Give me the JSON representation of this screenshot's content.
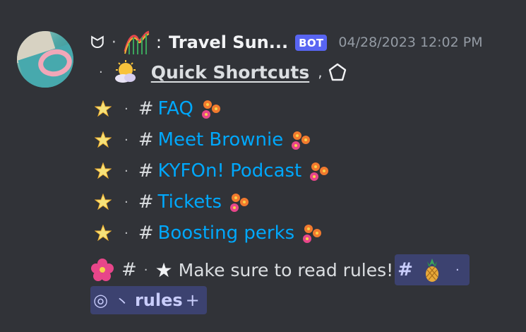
{
  "message": {
    "author": {
      "prefix_glyph": "ᗢ",
      "separator": "·",
      "colon": ":",
      "name": "Travel Sun...",
      "badge": "BOT",
      "avatar_icon": "avatar-pool-float"
    },
    "timestamp": "04/28/2023 12:02 PM",
    "shortcuts": {
      "dot": "·",
      "title": "Quick Shortcuts",
      "comma": ",",
      "icons": [
        "sun-cloud-emoji",
        "pentagon-icon"
      ]
    },
    "channels": [
      {
        "bullet": "·",
        "hash": "#",
        "name": "FAQ"
      },
      {
        "bullet": "·",
        "hash": "#",
        "name": "Meet Brownie"
      },
      {
        "bullet": "·",
        "hash": "#",
        "name": "KYFOn! Podcast"
      },
      {
        "bullet": "·",
        "hash": "#",
        "name": "Tickets"
      },
      {
        "bullet": "·",
        "hash": "#",
        "name": "Boosting perks"
      }
    ],
    "rules_line": {
      "hash": "#",
      "dot": "·",
      "star": "★",
      "text": "Make sure to read rules!",
      "channel_mention": {
        "hash": "#",
        "dot": "·",
        "icon": "pineapple-emoji"
      },
      "role_mention": {
        "ring": "◎",
        "mark": "丶",
        "name": "rules",
        "plus": "+"
      }
    }
  },
  "colors": {
    "background": "#313338",
    "link": "#00a8fc",
    "bot_badge": "#5865f2",
    "mention_bg": "#3c4270",
    "mention_text": "#c9cdfb",
    "timestamp": "#949ba4"
  }
}
